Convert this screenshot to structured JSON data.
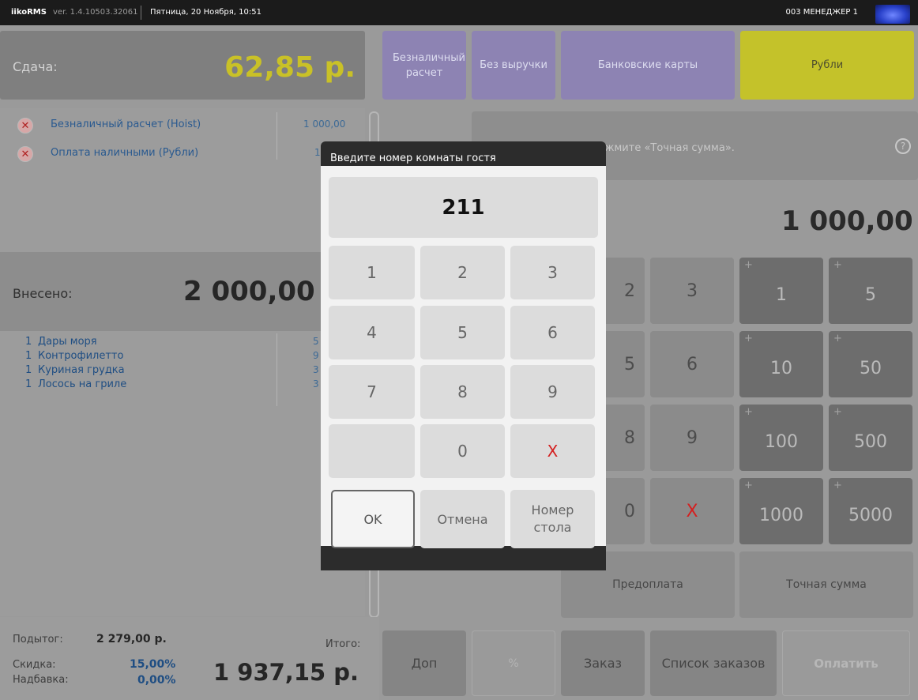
{
  "titlebar": {
    "app_name": "iikoRMS",
    "version": "ver. 1.4.10503.32061",
    "datetime": "Пятница, 20 Ноября, 10:51",
    "user": "003 МЕНЕДЖЕР 1"
  },
  "change": {
    "label": "Сдача:",
    "value": "62,85 р."
  },
  "top_buttons": {
    "cashless": "Безналичный расчет",
    "no_revenue": "Без выручки",
    "bank_cards": "Банковские карты",
    "rubles": "Рубли"
  },
  "payments": [
    {
      "name": "Безналичный расчет (Hoist)",
      "amount": "1 000,00"
    },
    {
      "name": "Оплата наличными (Рубли)",
      "amount": "1"
    }
  ],
  "deposited": {
    "label": "Внесено:",
    "value": "2 000,00"
  },
  "order_items": [
    {
      "qty": "1",
      "name": "Дары моря",
      "price": "5"
    },
    {
      "qty": "1",
      "name": "Контрофилетто",
      "price": "9"
    },
    {
      "qty": "1",
      "name": "Куриная грудка",
      "price": "3"
    },
    {
      "qty": "1",
      "name": "Лосось на гриле",
      "price": "3"
    }
  ],
  "totals": {
    "subtotal_label": "Подытог:",
    "subtotal": "2 279,00 р.",
    "discount_label": "Скидка:",
    "discount": "15,00%",
    "surcharge_label": "Надбавка:",
    "surcharge": "0,00%",
    "total_label": "Итого:",
    "total": "1 937,15 р."
  },
  "hint": {
    "text": "те сумму или нажмите «Точная сумма».",
    "help": "?"
  },
  "amount": "1 000,00",
  "keypad": {
    "k2": "2",
    "k3": "3",
    "k5": "5",
    "k6": "6",
    "k8": "8",
    "k9": "9",
    "k0": "0",
    "x": "X"
  },
  "quick": [
    {
      "plus": "+",
      "value": "1"
    },
    {
      "plus": "+",
      "value": "5"
    },
    {
      "plus": "+",
      "value": "10"
    },
    {
      "plus": "+",
      "value": "50"
    },
    {
      "plus": "+",
      "value": "100"
    },
    {
      "plus": "+",
      "value": "500"
    },
    {
      "plus": "+",
      "value": "1000"
    },
    {
      "plus": "+",
      "value": "5000"
    }
  ],
  "actions": {
    "prepay": "Предоплата",
    "exact": "Точная сумма"
  },
  "bottom_buttons": {
    "extra": "Доп",
    "percent": "%",
    "order": "Заказ",
    "orders_list": "Список заказов",
    "pay": "Оплатить"
  },
  "dialog": {
    "title": "Введите номер комнаты гостя",
    "value": "211",
    "keys": [
      "1",
      "2",
      "3",
      "4",
      "5",
      "6",
      "7",
      "8",
      "9",
      "",
      "0",
      "X"
    ],
    "ok": "OK",
    "cancel": "Отмена",
    "table_number": "Номер стола"
  },
  "colors": {
    "change_value": "#c9c127",
    "rubles_button": "#c4c22a",
    "purple_button": "#8d83b3",
    "delete_red": "#d42020"
  }
}
